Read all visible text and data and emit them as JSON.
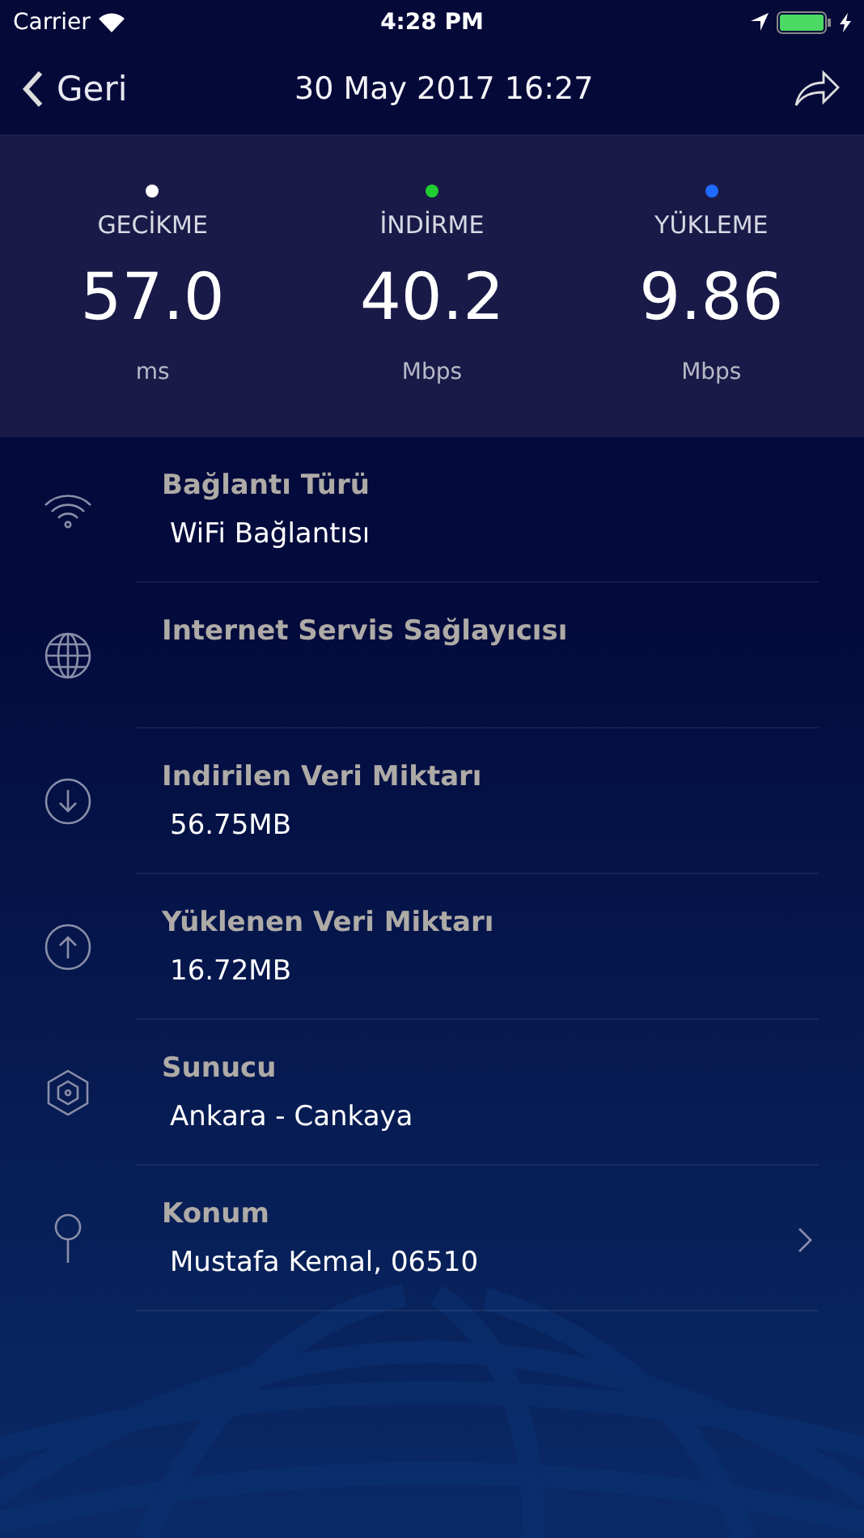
{
  "status_bar": {
    "carrier": "Carrier",
    "time": "4:28 PM"
  },
  "nav": {
    "back": "Geri",
    "title": "30 May 2017 16:27"
  },
  "metrics": [
    {
      "label": "GECİKME",
      "value": "57.0",
      "unit": "ms",
      "color": "#ffffff"
    },
    {
      "label": "İNDİRME",
      "value": "40.2",
      "unit": "Mbps",
      "color": "#22cc33"
    },
    {
      "label": "YÜKLEME",
      "value": "9.86",
      "unit": "Mbps",
      "color": "#1f6bff"
    }
  ],
  "details": [
    {
      "kind": "wifi",
      "title": "Bağlantı Türü",
      "value": "WiFi Bağlantısı",
      "has_detail": false
    },
    {
      "kind": "globe",
      "title": "Internet Servis Sağlayıcısı",
      "has_detail": false
    },
    {
      "kind": "download",
      "title": "Indirilen Veri Miktarı",
      "value": "56.75MB",
      "has_detail": false
    },
    {
      "kind": "upload",
      "title": "Yüklenen Veri Miktarı",
      "value": "16.72MB",
      "has_detail": false
    },
    {
      "kind": "server",
      "title": "Sunucu",
      "value": "Ankara - Cankaya",
      "has_detail": false
    },
    {
      "kind": "pin",
      "title": "Konum",
      "value": "Mustafa Kemal, 06510",
      "has_detail": true
    }
  ]
}
